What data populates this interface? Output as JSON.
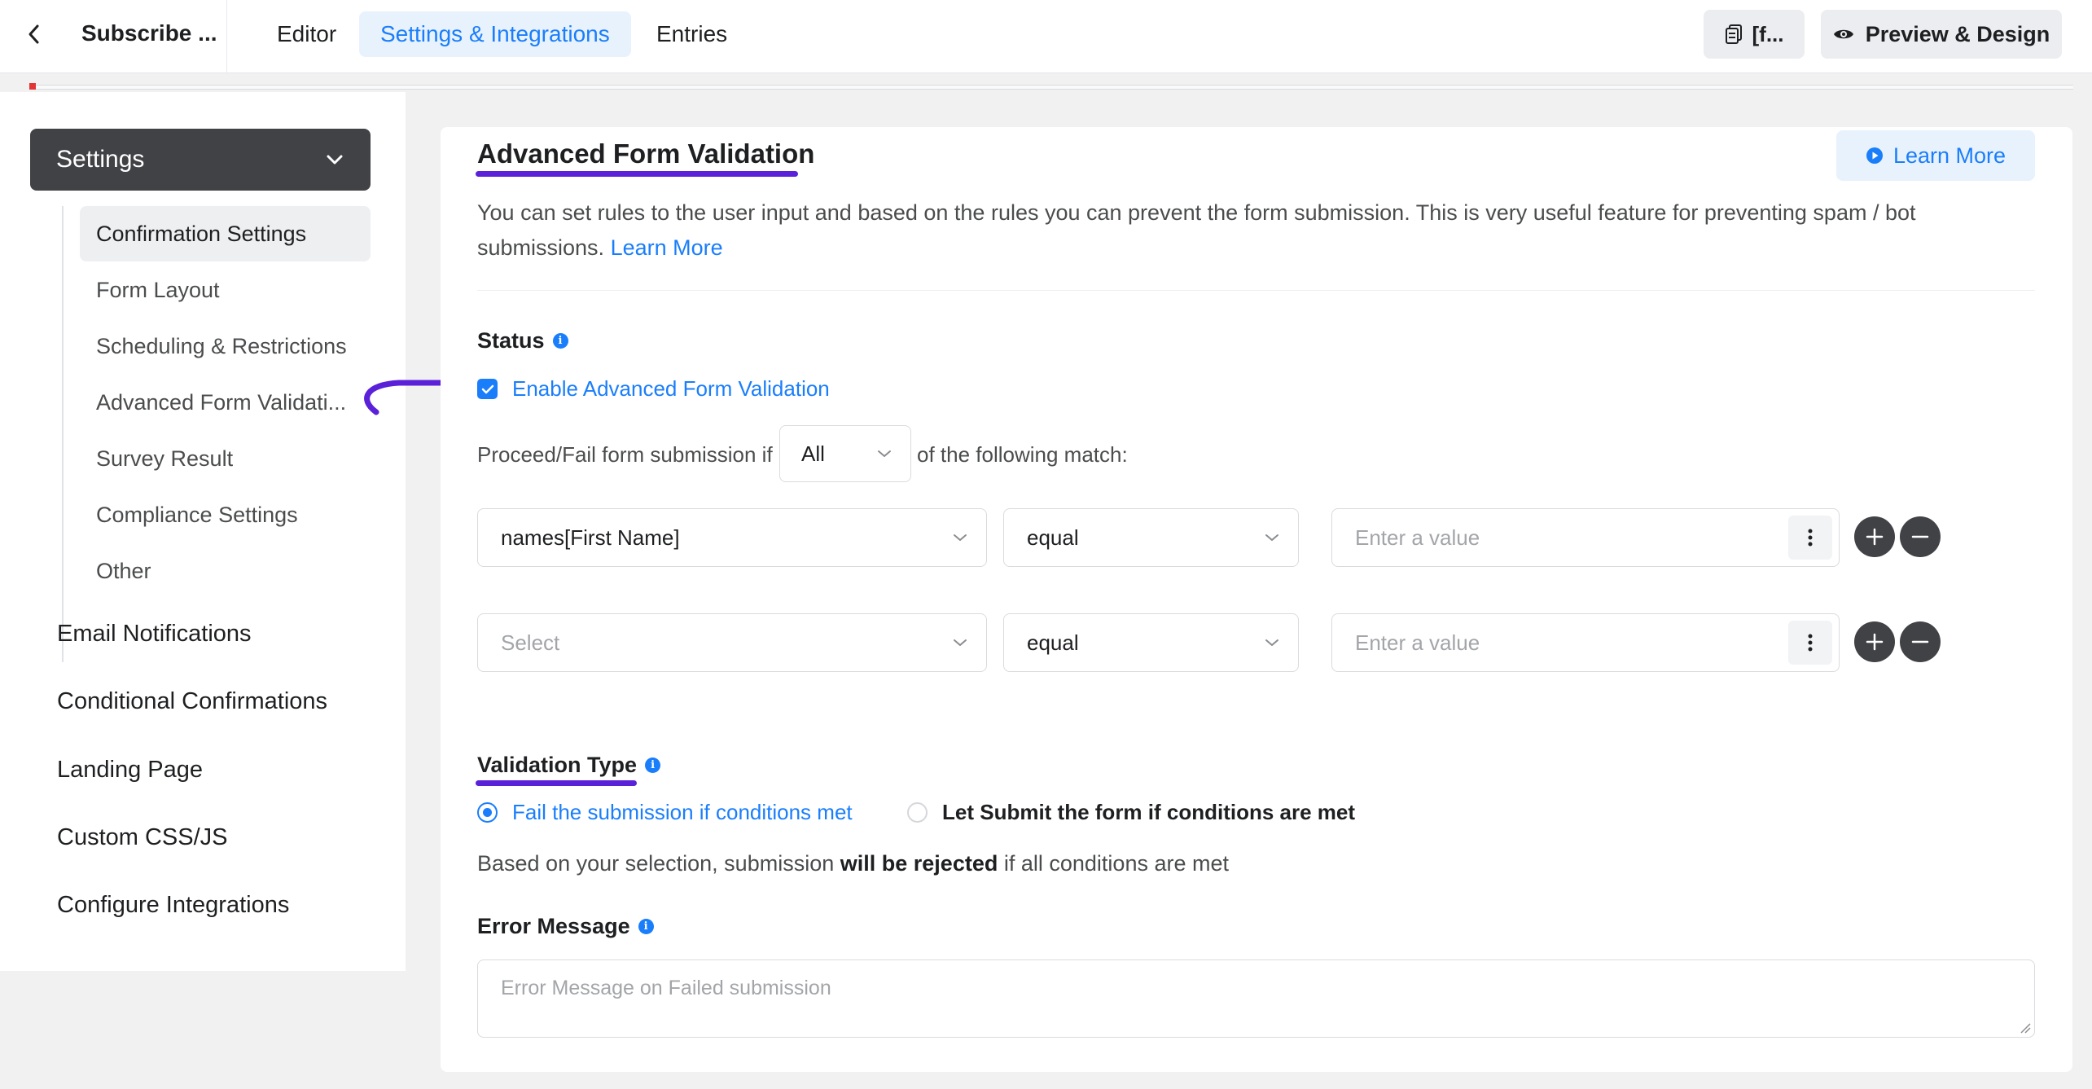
{
  "header": {
    "form_title": "Subscribe ...",
    "tabs": [
      {
        "label": "Editor",
        "active": false
      },
      {
        "label": "Settings & Integrations",
        "active": true
      },
      {
        "label": "Entries",
        "active": false
      }
    ],
    "shortcode_label": "[f...",
    "preview_label": "Preview & Design"
  },
  "sidebar": {
    "section_label": "Settings",
    "sub_items": [
      {
        "label": "Confirmation Settings",
        "active": true
      },
      {
        "label": "Form Layout",
        "active": false
      },
      {
        "label": "Scheduling & Restrictions",
        "active": false
      },
      {
        "label": "Advanced Form Validati...",
        "active": false
      },
      {
        "label": "Survey Result",
        "active": false
      },
      {
        "label": "Compliance Settings",
        "active": false
      },
      {
        "label": "Other",
        "active": false
      }
    ],
    "main_items": [
      "Email Notifications",
      "Conditional Confirmations",
      "Landing Page",
      "Custom CSS/JS",
      "Configure Integrations"
    ]
  },
  "main": {
    "title": "Advanced Form Validation",
    "learn_more_button": "Learn More",
    "description": "You can set rules to the user input and based on the rules you can prevent the form submission. This is very useful feature for preventing spam / bot submissions.",
    "description_link": "Learn More",
    "status_label": "Status",
    "enable_checkbox_label": "Enable Advanced Form Validation",
    "enable_checked": true,
    "proceed_prefix": "Proceed/Fail form submission if",
    "match_value": "All",
    "proceed_suffix": "of the following match:",
    "conditions": [
      {
        "field": "names[First Name]",
        "field_is_placeholder": false,
        "operator": "equal",
        "value_placeholder": "Enter a value"
      },
      {
        "field": "Select",
        "field_is_placeholder": true,
        "operator": "equal",
        "value_placeholder": "Enter a value"
      }
    ],
    "validation_type_label": "Validation Type",
    "validation_options": [
      {
        "label": "Fail the submission if conditions met",
        "checked": true
      },
      {
        "label": "Let Submit the form if conditions are met",
        "checked": false
      }
    ],
    "based_on_prefix": "Based on your selection, submission",
    "based_on_bold": "will be rejected",
    "based_on_suffix": "if all conditions are met",
    "error_message_label": "Error Message",
    "error_message_placeholder": "Error Message on Failed submission"
  },
  "colors": {
    "accent": "#1a7efb",
    "annotation": "#5b21d9",
    "dark_button": "#414246"
  },
  "icons": [
    "chevron-left-icon",
    "shortcode-icon",
    "eye-icon",
    "chevron-down-icon",
    "play-circle-icon",
    "info-icon",
    "check-icon",
    "kebab-icon",
    "plus-icon",
    "minus-icon",
    "resize-grip-icon",
    "annotation-arrow-icon"
  ]
}
